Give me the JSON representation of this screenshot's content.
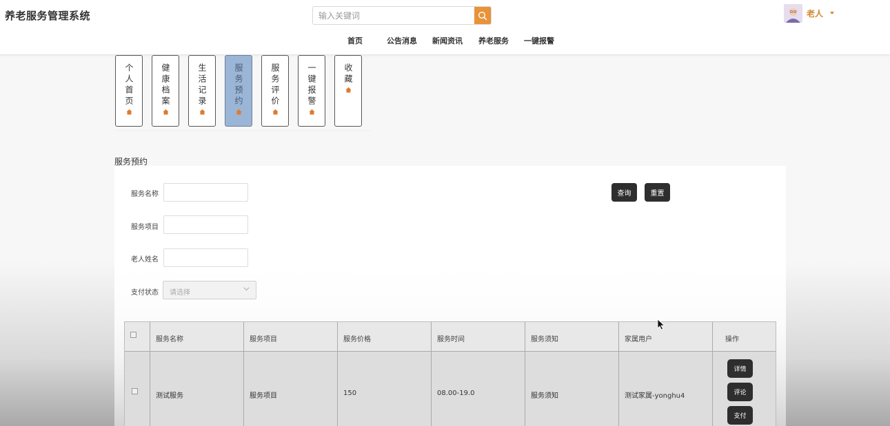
{
  "app": {
    "title": "养老服务管理系统"
  },
  "search": {
    "placeholder": "输入关键词"
  },
  "user": {
    "name": "老人"
  },
  "nav": {
    "items": [
      {
        "label": "首页"
      },
      {
        "label": "公告消息"
      },
      {
        "label": "新闻资讯"
      },
      {
        "label": "养老服务"
      },
      {
        "label": "一键报警"
      }
    ]
  },
  "side_tabs": [
    {
      "label": "个人首页",
      "active": false
    },
    {
      "label": "健康档案",
      "active": false
    },
    {
      "label": "生活记录",
      "active": false
    },
    {
      "label": "服务预约",
      "active": true
    },
    {
      "label": "服务评价",
      "active": false
    },
    {
      "label": "一键报警",
      "active": false
    },
    {
      "label": "收藏",
      "active": false
    }
  ],
  "section": {
    "title": "服务预约"
  },
  "form": {
    "service_name_label": "服务名称",
    "service_item_label": "服务项目",
    "elder_name_label": "老人姓名",
    "pay_status_label": "支付状态",
    "pay_status_placeholder": "请选择",
    "query_label": "查询",
    "reset_label": "重置"
  },
  "table": {
    "headers": [
      "服务名称",
      "服务项目",
      "服务价格",
      "服务时间",
      "服务须知",
      "家属用户",
      "操作"
    ],
    "rows": [
      {
        "service_name": "测试服务",
        "service_item": "服务项目",
        "price": "150",
        "time": "08.00-19.0",
        "notice": "服务须知",
        "family_user": "测试家属-yonghu4",
        "actions": [
          "详情",
          "评论",
          "支付"
        ]
      }
    ]
  },
  "colors": {
    "accent": "#e8923a",
    "active_tab": "#9bb5d6",
    "dark_button": "#2e2e2e",
    "user_name": "#d4852f"
  }
}
